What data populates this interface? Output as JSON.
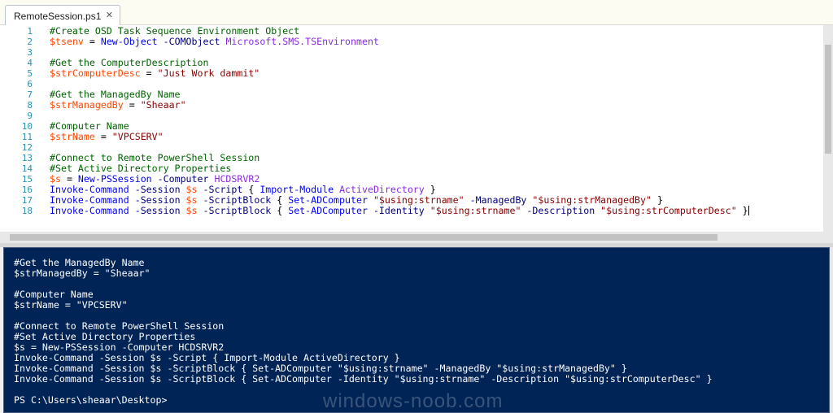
{
  "tab": {
    "title": "RemoteSession.ps1",
    "close_glyph": "✕"
  },
  "editor": {
    "line_numbers": [
      "1",
      "2",
      "3",
      "4",
      "5",
      "6",
      "7",
      "8",
      "9",
      "10",
      "11",
      "12",
      "13",
      "14",
      "15",
      "16",
      "17",
      "18"
    ],
    "lines": [
      [
        [
          "cm",
          "#Create OSD Task Sequence Environment Object"
        ]
      ],
      [
        [
          "var",
          "$tsenv"
        ],
        [
          "pl",
          " = "
        ],
        [
          "cmd",
          "New-Object"
        ],
        [
          "pl",
          " "
        ],
        [
          "prm",
          "-COMObject"
        ],
        [
          "pl",
          " "
        ],
        [
          "typ",
          "Microsoft.SMS.TSEnvironment"
        ]
      ],
      [],
      [
        [
          "cm",
          "#Get the ComputerDescription"
        ]
      ],
      [
        [
          "var",
          "$strComputerDesc"
        ],
        [
          "pl",
          " = "
        ],
        [
          "str",
          "\"Just Work dammit\""
        ]
      ],
      [],
      [
        [
          "cm",
          "#Get the ManagedBy Name"
        ]
      ],
      [
        [
          "var",
          "$strManagedBy"
        ],
        [
          "pl",
          " = "
        ],
        [
          "str",
          "\"Sheaar\""
        ]
      ],
      [],
      [
        [
          "cm",
          "#Computer Name"
        ]
      ],
      [
        [
          "var",
          "$strName"
        ],
        [
          "pl",
          " = "
        ],
        [
          "str",
          "\"VPCSERV\""
        ]
      ],
      [],
      [
        [
          "cm",
          "#Connect to Remote PowerShell Session"
        ]
      ],
      [
        [
          "cm",
          "#Set Active Directory Properties"
        ]
      ],
      [
        [
          "var",
          "$s"
        ],
        [
          "pl",
          " = "
        ],
        [
          "cmd",
          "New-PSSession"
        ],
        [
          "pl",
          " "
        ],
        [
          "prm",
          "-Computer"
        ],
        [
          "pl",
          " "
        ],
        [
          "typ",
          "HCDSRVR2"
        ]
      ],
      [
        [
          "cmd",
          "Invoke-Command"
        ],
        [
          "pl",
          " "
        ],
        [
          "prm",
          "-Session"
        ],
        [
          "pl",
          " "
        ],
        [
          "var",
          "$s"
        ],
        [
          "pl",
          " "
        ],
        [
          "prm",
          "-Script"
        ],
        [
          "pl",
          " { "
        ],
        [
          "cmd",
          "Import-Module"
        ],
        [
          "pl",
          " "
        ],
        [
          "typ",
          "ActiveDirectory"
        ],
        [
          "pl",
          " }"
        ]
      ],
      [
        [
          "cmd",
          "Invoke-Command"
        ],
        [
          "pl",
          " "
        ],
        [
          "prm",
          "-Session"
        ],
        [
          "pl",
          " "
        ],
        [
          "var",
          "$s"
        ],
        [
          "pl",
          " "
        ],
        [
          "prm",
          "-ScriptBlock"
        ],
        [
          "pl",
          " { "
        ],
        [
          "cmd",
          "Set-ADComputer"
        ],
        [
          "pl",
          " "
        ],
        [
          "str",
          "\"$using:strname\""
        ],
        [
          "pl",
          " "
        ],
        [
          "prm",
          "-ManagedBy"
        ],
        [
          "pl",
          " "
        ],
        [
          "str",
          "\"$using:strManagedBy\""
        ],
        [
          "pl",
          " }"
        ]
      ],
      [
        [
          "cmd",
          "Invoke-Command"
        ],
        [
          "pl",
          " "
        ],
        [
          "prm",
          "-Session"
        ],
        [
          "pl",
          " "
        ],
        [
          "var",
          "$s"
        ],
        [
          "pl",
          " "
        ],
        [
          "prm",
          "-ScriptBlock"
        ],
        [
          "pl",
          " { "
        ],
        [
          "cmd",
          "Set-ADComputer"
        ],
        [
          "pl",
          " "
        ],
        [
          "prm",
          "-Identity"
        ],
        [
          "pl",
          " "
        ],
        [
          "str",
          "\"$using:strname\""
        ],
        [
          "pl",
          " "
        ],
        [
          "prm",
          "-Description"
        ],
        [
          "pl",
          " "
        ],
        [
          "str",
          "\"$using:strComputerDesc\""
        ],
        [
          "pl",
          " }"
        ]
      ]
    ]
  },
  "console": {
    "lines": [
      "#Get the ManagedBy Name",
      "$strManagedBy = \"Sheaar\"",
      "",
      "#Computer Name",
      "$strName = \"VPCSERV\"",
      "",
      "#Connect to Remote PowerShell Session",
      "#Set Active Directory Properties",
      "$s = New-PSSession -Computer HCDSRVR2",
      "Invoke-Command -Session $s -Script { Import-Module ActiveDirectory }",
      "Invoke-Command -Session $s -ScriptBlock { Set-ADComputer \"$using:strname\" -ManagedBy \"$using:strManagedBy\" }",
      "Invoke-Command -Session $s -ScriptBlock { Set-ADComputer -Identity \"$using:strname\" -Description \"$using:strComputerDesc\" }",
      "",
      "PS C:\\Users\\sheaar\\Desktop>"
    ]
  },
  "watermark": "windows-noob.com",
  "colors": {
    "console_bg": "#012456",
    "comment": "#006400",
    "variable": "#ff4500",
    "command": "#0000ff",
    "parameter": "#000080",
    "string": "#8b0000",
    "type": "#8a2be2",
    "line_number": "#2b91af"
  }
}
